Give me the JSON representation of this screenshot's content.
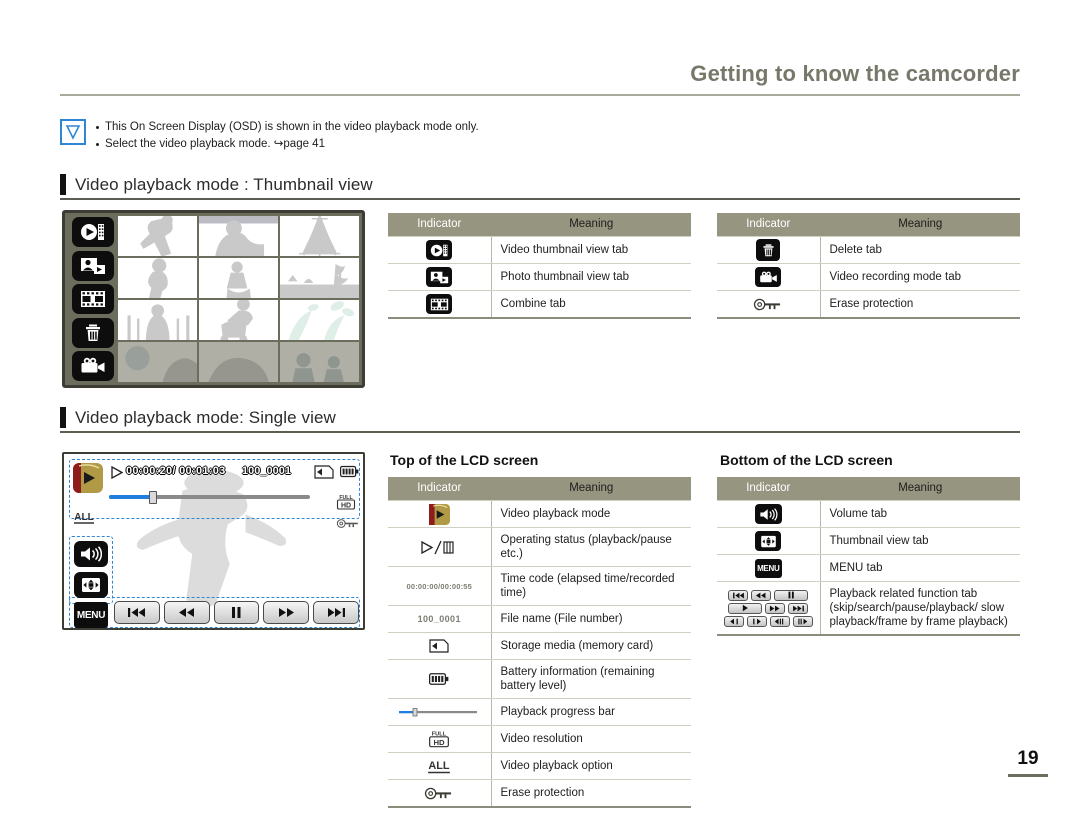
{
  "header": {
    "title": "Getting to know the camcorder"
  },
  "note": {
    "icon": "checkmark-note-icon",
    "lines": [
      "This On Screen Display (OSD) is shown in the video playback mode only.",
      "Select the video playback mode. ↪page 41"
    ]
  },
  "sections": {
    "thumbnail": {
      "title": "Video playback mode : Thumbnail view"
    },
    "single": {
      "title": "Video playback mode: Single view"
    }
  },
  "thumbnail_lcd": {
    "tabs": [
      {
        "name": "video-thumbnail-view-tab"
      },
      {
        "name": "photo-thumbnail-view-tab"
      },
      {
        "name": "combine-tab"
      },
      {
        "name": "delete-tab"
      },
      {
        "name": "video-recording-mode-tab"
      }
    ],
    "overlay_icon": "erase-protection-icon"
  },
  "single_lcd": {
    "mode_icon": "video-playback-mode-icon",
    "play_status": "▷",
    "time_code": "00:00:20/ 00:01:03",
    "file_name": "100_0001",
    "storage_icon": "memory-card-icon",
    "battery_icon": "battery-icon",
    "resolution_label_top": "FULL",
    "resolution_label_bottom": "HD",
    "playback_option": "ALL",
    "erase_protection_icon": "erase-protection-icon",
    "volume_tab": "volume-tab",
    "thumbnail_tab": "thumbnail-view-tab",
    "menu_label": "MENU",
    "progress_percent": 22,
    "transport_buttons": [
      "skip-backward-button",
      "rewind-button",
      "pause-button",
      "fast-forward-button",
      "skip-forward-button"
    ]
  },
  "tables": {
    "columns": {
      "indicator": "Indicator",
      "meaning": "Meaning"
    },
    "thumb_left": {
      "rows": [
        {
          "icon": "video-thumbnail-view-tab",
          "meaning": "Video thumbnail view tab"
        },
        {
          "icon": "photo-thumbnail-view-tab",
          "meaning": "Photo thumbnail view tab"
        },
        {
          "icon": "combine-tab",
          "meaning": "Combine tab"
        }
      ]
    },
    "thumb_right": {
      "rows": [
        {
          "icon": "delete-tab",
          "meaning": "Delete tab"
        },
        {
          "icon": "video-recording-mode-tab",
          "meaning": "Video recording mode tab"
        },
        {
          "icon": "erase-protection-icon",
          "meaning": "Erase protection"
        }
      ]
    },
    "top_lcd": {
      "title": "Top of the LCD screen",
      "rows": [
        {
          "icon": "video-playback-mode-icon",
          "meaning": "Video playback mode"
        },
        {
          "icon": "play-pause-icon",
          "label": "▷/‖",
          "meaning": "Operating status (playback/pause etc.)"
        },
        {
          "icon": "time-code-text",
          "label": "00:00:00/00:00:55",
          "meaning": "Time code (elapsed time/recorded time)"
        },
        {
          "icon": "file-name-text",
          "label": "100_0001",
          "meaning": "File name (File number)"
        },
        {
          "icon": "memory-card-icon",
          "meaning": "Storage media (memory card)"
        },
        {
          "icon": "battery-icon",
          "meaning": "Battery information (remaining battery level)"
        },
        {
          "icon": "progress-bar-icon",
          "meaning": "Playback progress bar"
        },
        {
          "icon": "full-hd-icon",
          "meaning": "Video resolution"
        },
        {
          "icon": "playback-option-all-icon",
          "meaning": "Video playback option"
        },
        {
          "icon": "erase-protection-icon",
          "meaning": "Erase protection"
        }
      ]
    },
    "bottom_lcd": {
      "title": "Bottom of the LCD screen",
      "rows": [
        {
          "icon": "volume-tab-icon",
          "meaning": "Volume tab"
        },
        {
          "icon": "thumbnail-view-tab-icon",
          "meaning": "Thumbnail view tab"
        },
        {
          "icon": "menu-tab-icon",
          "label": "MENU",
          "meaning": "MENU tab"
        },
        {
          "icon": "playback-function-tabs-icon",
          "meaning": "Playback related function tab (skip/search/pause/playback/ slow playback/frame by frame playback)"
        }
      ]
    }
  },
  "footer": {
    "page_number": "19"
  },
  "colors": {
    "table_header": "#969580",
    "accent_blue": "#2f86d6",
    "heading_gray": "#77776a",
    "progress_fill": "#1f7ee0"
  }
}
